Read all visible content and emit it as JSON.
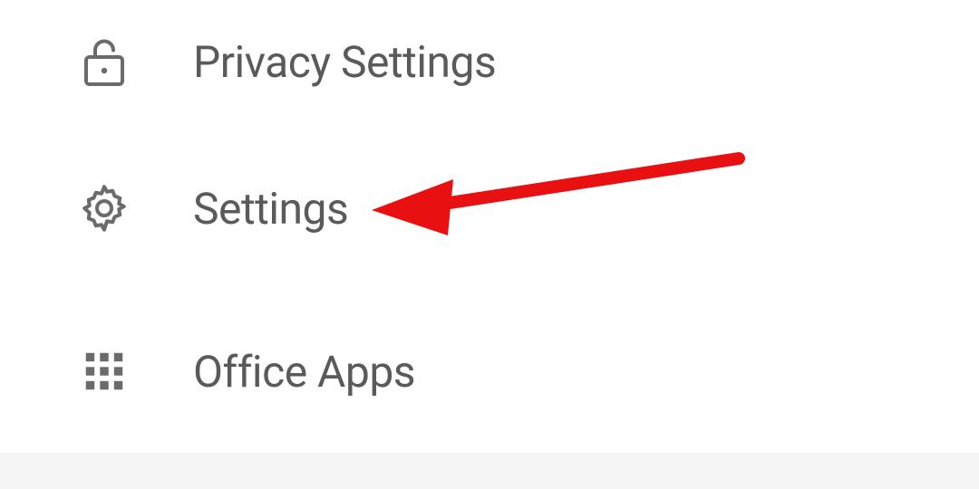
{
  "menu": {
    "items": [
      {
        "label": "Privacy Settings"
      },
      {
        "label": "Settings"
      },
      {
        "label": "Office Apps"
      }
    ]
  },
  "annotation": {
    "target": "settings",
    "color": "#e81010"
  }
}
